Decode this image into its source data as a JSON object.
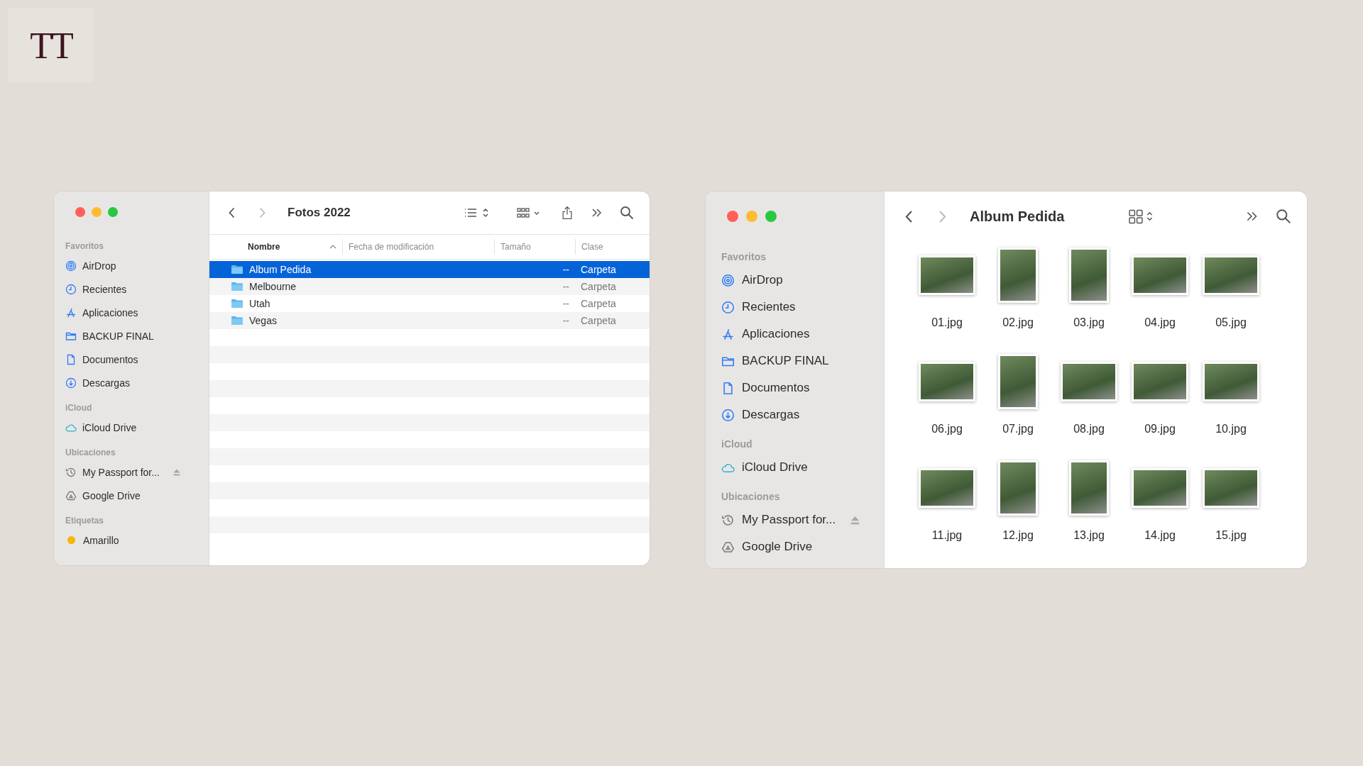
{
  "logo": "TT",
  "windows": [
    {
      "kind": "list",
      "title": "Fotos 2022",
      "back_enabled": true,
      "forward_enabled": false,
      "sidebar": [
        {
          "heading": "Favoritos",
          "items": [
            {
              "kind": "airdrop",
              "label": "AirDrop"
            },
            {
              "kind": "clock",
              "label": "Recientes"
            },
            {
              "kind": "apps",
              "label": "Aplicaciones"
            },
            {
              "kind": "folder",
              "label": "BACKUP FINAL"
            },
            {
              "kind": "doc",
              "label": "Documentos"
            },
            {
              "kind": "download",
              "label": "Descargas"
            }
          ]
        },
        {
          "heading": "iCloud",
          "items": [
            {
              "kind": "cloud",
              "label": "iCloud Drive"
            }
          ]
        },
        {
          "heading": "Ubicaciones",
          "items": [
            {
              "kind": "history",
              "label": "My Passport for...",
              "ejectable": true
            },
            {
              "kind": "drive",
              "label": "Google Drive"
            }
          ]
        },
        {
          "heading": "Etiquetas",
          "items": [
            {
              "kind": "tag",
              "label": "Amarillo",
              "color": "#f5b800"
            }
          ]
        }
      ],
      "columns": [
        {
          "label": "Nombre",
          "sorted": true
        },
        {
          "label": "Fecha de modificación",
          "sorted": false
        },
        {
          "label": "Tamaño",
          "sorted": false
        },
        {
          "label": "Clase",
          "sorted": false
        }
      ],
      "rows": [
        {
          "name": "Album Pedida",
          "size": "--",
          "kind": "Carpeta",
          "selected": true
        },
        {
          "name": "Melbourne",
          "size": "--",
          "kind": "Carpeta",
          "selected": false
        },
        {
          "name": "Utah",
          "size": "--",
          "kind": "Carpeta",
          "selected": false
        },
        {
          "name": "Vegas",
          "size": "--",
          "kind": "Carpeta",
          "selected": false
        }
      ]
    },
    {
      "kind": "grid",
      "title": "Album Pedida",
      "back_enabled": true,
      "forward_enabled": false,
      "sidebar": [
        {
          "heading": "Favoritos",
          "items": [
            {
              "kind": "airdrop",
              "label": "AirDrop"
            },
            {
              "kind": "clock",
              "label": "Recientes"
            },
            {
              "kind": "apps",
              "label": "Aplicaciones"
            },
            {
              "kind": "folder",
              "label": "BACKUP FINAL"
            },
            {
              "kind": "doc",
              "label": "Documentos"
            },
            {
              "kind": "download",
              "label": "Descargas"
            }
          ]
        },
        {
          "heading": "iCloud",
          "items": [
            {
              "kind": "cloud",
              "label": "iCloud Drive"
            }
          ]
        },
        {
          "heading": "Ubicaciones",
          "items": [
            {
              "kind": "history",
              "label": "My Passport for...",
              "ejectable": true
            },
            {
              "kind": "drive",
              "label": "Google Drive"
            }
          ]
        }
      ],
      "files": [
        {
          "name": "01.jpg",
          "kind": "landscape"
        },
        {
          "name": "02.jpg",
          "kind": "portrait"
        },
        {
          "name": "03.jpg",
          "kind": "portrait"
        },
        {
          "name": "04.jpg",
          "kind": "landscape"
        },
        {
          "name": "05.jpg",
          "kind": "landscape"
        },
        {
          "name": "06.jpg",
          "kind": "landscape"
        },
        {
          "name": "07.jpg",
          "kind": "portrait"
        },
        {
          "name": "08.jpg",
          "kind": "landscape"
        },
        {
          "name": "09.jpg",
          "kind": "landscape"
        },
        {
          "name": "10.jpg",
          "kind": "landscape"
        },
        {
          "name": "11.jpg",
          "kind": "landscape"
        },
        {
          "name": "12.jpg",
          "kind": "portrait"
        },
        {
          "name": "13.jpg",
          "kind": "portrait"
        },
        {
          "name": "14.jpg",
          "kind": "landscape"
        },
        {
          "name": "15.jpg",
          "kind": "landscape"
        }
      ]
    }
  ]
}
